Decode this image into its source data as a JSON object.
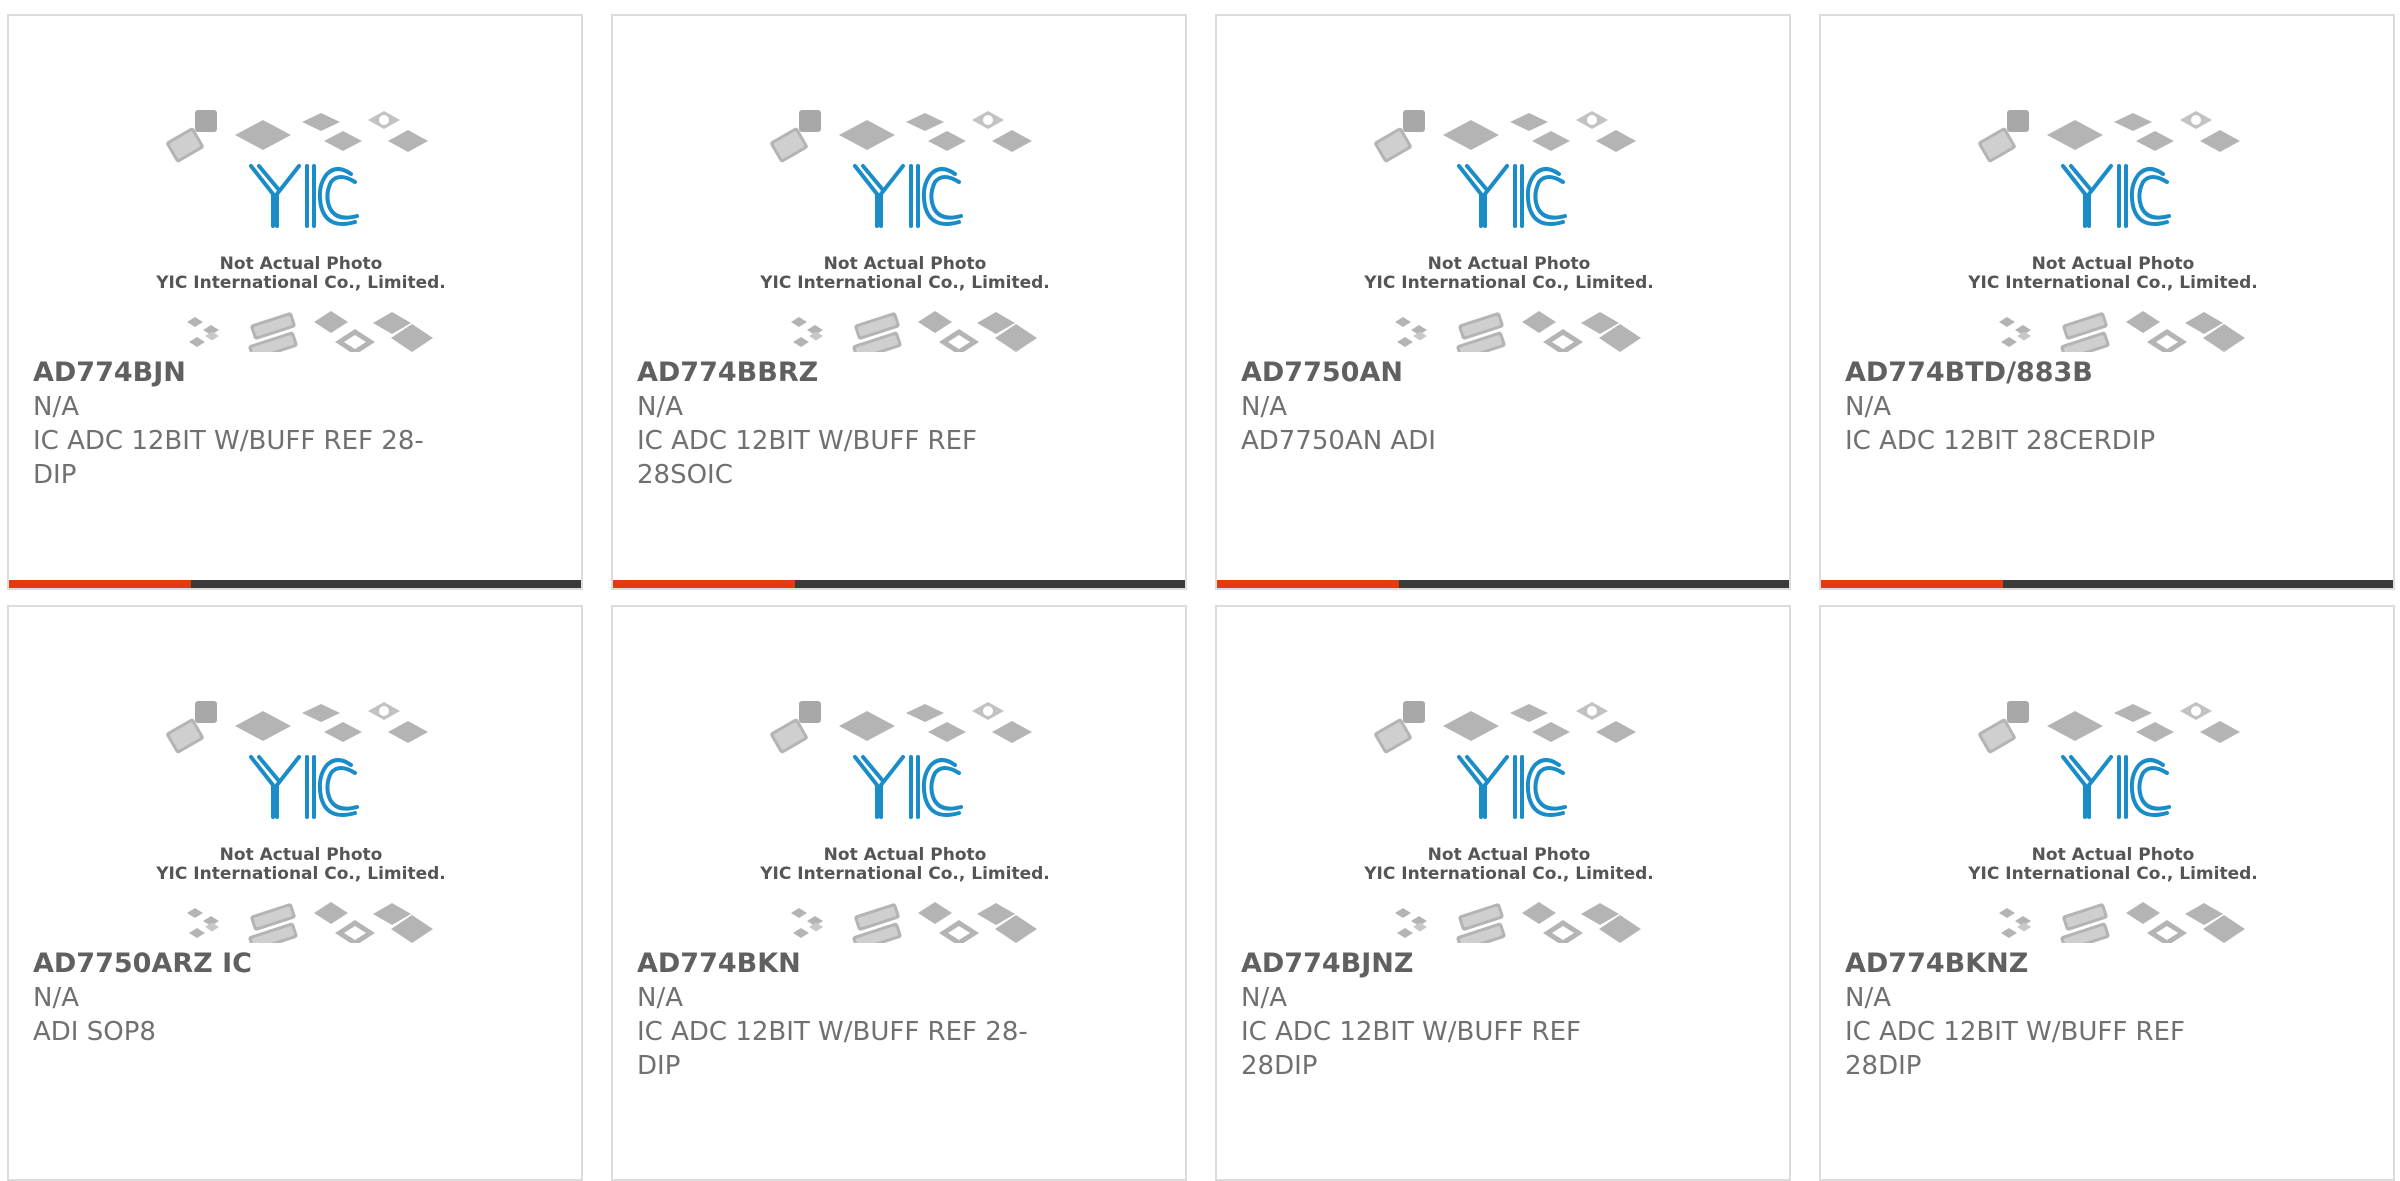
{
  "colors": {
    "accent": "#e33a10",
    "bar_dark": "#3a3a3a",
    "logo_blue": "#1a8cc7",
    "chip_gray": "#b4b4b4",
    "text_gray": "#666666"
  },
  "placeholder": {
    "brand": "YIC",
    "line1": "Not Actual Photo",
    "line2": "YIC International Co., Limited."
  },
  "products": [
    {
      "name": "AD774BJN",
      "mfr": "N/A",
      "desc": "IC ADC 12BIT W/BUFF REF 28-DIP",
      "show_bar": true
    },
    {
      "name": "AD774BBRZ",
      "mfr": "N/A",
      "desc": "IC ADC 12BIT W/BUFF REF 28SOIC",
      "show_bar": true
    },
    {
      "name": "AD7750AN",
      "mfr": "N/A",
      "desc": "AD7750AN ADI",
      "show_bar": true
    },
    {
      "name": "AD774BTD/883B",
      "mfr": "N/A",
      "desc": "IC ADC 12BIT 28CERDIP",
      "show_bar": true
    },
    {
      "name": "AD7750ARZ IC",
      "mfr": "N/A",
      "desc": "ADI SOP8",
      "show_bar": false
    },
    {
      "name": "AD774BKN",
      "mfr": "N/A",
      "desc": "IC ADC 12BIT W/BUFF REF 28-DIP",
      "show_bar": false
    },
    {
      "name": "AD774BJNZ",
      "mfr": "N/A",
      "desc": "IC ADC 12BIT W/BUFF REF 28DIP",
      "show_bar": false
    },
    {
      "name": "AD774BKNZ",
      "mfr": "N/A",
      "desc": "IC ADC 12BIT W/BUFF REF 28DIP",
      "show_bar": false
    }
  ]
}
